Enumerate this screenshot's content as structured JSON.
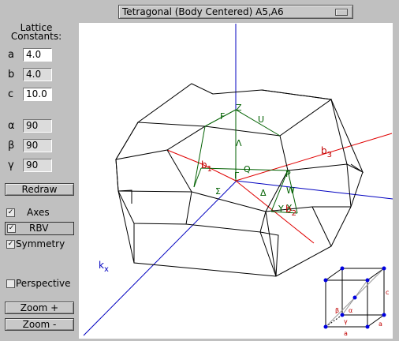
{
  "lattice_select": {
    "value": "Tetragonal (Body Centered) A5,A6"
  },
  "panel": {
    "heading_line1": "Lattice",
    "heading_line2": "Constants:",
    "a": {
      "label": "a",
      "value": "4.0"
    },
    "b": {
      "label": "b",
      "value": "4.0"
    },
    "c": {
      "label": "c",
      "value": "10.0"
    },
    "alpha": {
      "label": "α",
      "value": "90"
    },
    "beta": {
      "label": "β",
      "value": "90"
    },
    "gamma": {
      "label": "γ",
      "value": "90"
    },
    "redraw": "Redraw",
    "axes": {
      "label": "Axes",
      "checked": true
    },
    "rbv": {
      "label": "RBV",
      "checked": true
    },
    "symmetry": {
      "label": "Symmetry",
      "checked": true
    },
    "perspective": {
      "label": "Perspective",
      "checked": false
    },
    "zoom_in": "Zoom +",
    "zoom_out": "Zoom -"
  },
  "viewport": {
    "axis_labels": {
      "kx": "k",
      "kx_sub": "x",
      "b1": "b",
      "b1_sub": "1",
      "b2": "b",
      "b2_sub": "2",
      "b3": "b",
      "b3_sub": "3"
    },
    "symmetry_labels": {
      "gamma": "Γ",
      "Z": "Z",
      "F": "F",
      "U": "U",
      "Lambda": "Λ",
      "Q": "Q",
      "P": "P",
      "Sigma": "Σ",
      "Delta": "Δ",
      "W": "W",
      "Y": "Y",
      "X": "X"
    },
    "colors": {
      "wireframe": "#000000",
      "kx_axis": "#0000c0",
      "b_vectors": "#e00000",
      "symmetry": "#006000",
      "inset_points": "#0000e0",
      "inset_text": "#c00000"
    },
    "inset": {
      "labels": {
        "c": "c",
        "a_bottom": "a",
        "a_right": "a",
        "alpha": "α",
        "beta": "β",
        "gamma": "γ"
      }
    }
  }
}
